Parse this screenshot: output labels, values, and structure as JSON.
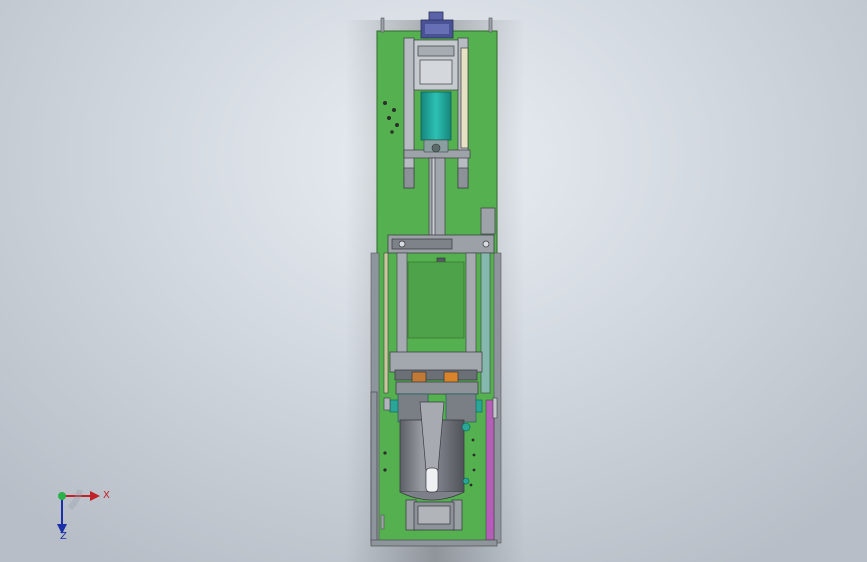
{
  "viewport": {
    "background_top": "#e9eef3",
    "background_bottom": "#b7bec7"
  },
  "model": {
    "plate_color": "#55b04f",
    "frame_color": "#9aa0a6",
    "cylinder_color": "#7d8088",
    "teal_color": "#1fa59a",
    "motor_color": "#4a5296",
    "accent_orange": "#d9842b",
    "accent_magenta": "#c650c8"
  },
  "triad": {
    "x_label": "X",
    "z_label": "Z",
    "x_color": "#c0222a",
    "y_color": "#2bb04a",
    "z_color": "#1a2fa8"
  }
}
